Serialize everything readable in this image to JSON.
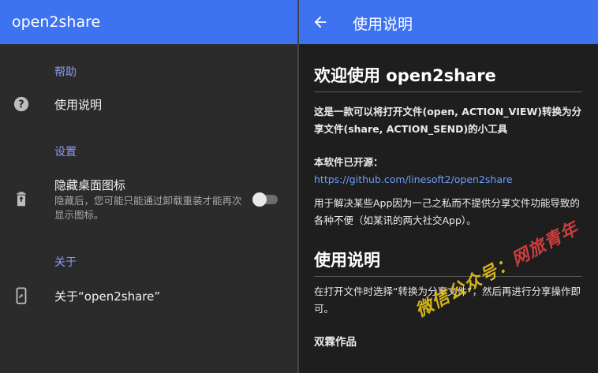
{
  "settings": {
    "app_title": "open2share",
    "sections": {
      "help": "帮助",
      "settings": "设置",
      "about": "关于"
    },
    "items": {
      "usage": {
        "title": "使用说明"
      },
      "hide_icon": {
        "title": "隐藏桌面图标",
        "summary": "隐藏后，您可能只能通过卸载重装才能再次显示图标。",
        "enabled": false
      },
      "about": {
        "title": "关于“open2share”"
      }
    }
  },
  "help_page": {
    "title": "使用说明",
    "heading1": "欢迎使用 open2share",
    "intro": "这是一款可以将打开文件(open, ACTION_VIEW)转换为分享文件(share, ACTION_SEND)的小工具",
    "open_source_label": "本软件已开源：",
    "repo_link": "https://github.com/linesoft2/open2share",
    "purpose": "用于解决某些App因为一己之私而不提供分享文件功能导致的各种不便（如某讯的两大社交App）。",
    "heading2": "使用说明",
    "usage_text": "在打开文件时选择“转换为分享文件”，然后再进行分享操作即可。",
    "author": "双霖作品"
  },
  "watermark": {
    "prefix": "微信公众号：",
    "name": "网旅青年"
  },
  "colors": {
    "app_bar": "#3d73f0",
    "section_header": "#8a9cf5",
    "link": "#6f9dff",
    "watermark": "#e8c418"
  }
}
